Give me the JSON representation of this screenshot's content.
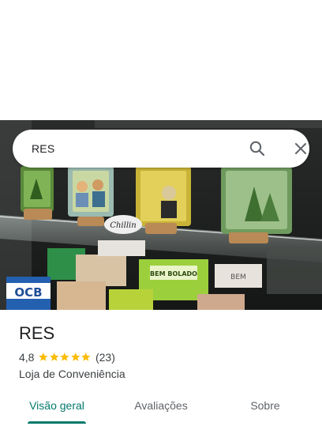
{
  "search": {
    "query": "RES"
  },
  "place": {
    "title": "RES",
    "rating": "4,8",
    "stars": 5,
    "reviews": "(23)",
    "category": "Loja de Conveniência"
  },
  "tabs": [
    {
      "label": "Visão geral",
      "active": true
    },
    {
      "label": "Avaliações",
      "active": false
    },
    {
      "label": "Sobre",
      "active": false
    }
  ],
  "photo": {
    "labels": {
      "ocb": "OCB",
      "chillin": "Chillin",
      "bem_bolado": "BEM BOLADO",
      "bem": "BEM"
    }
  },
  "colors": {
    "accent": "#00796b",
    "star": "#fbbc04"
  }
}
